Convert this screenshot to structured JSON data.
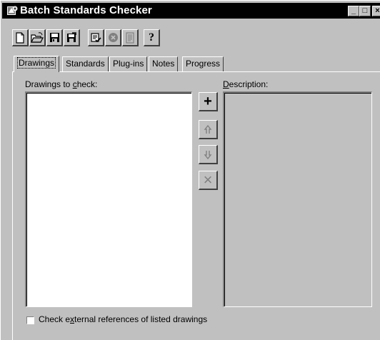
{
  "window": {
    "title": "Batch Standards Checker",
    "controls": {
      "minimize": "_",
      "maximize": "□",
      "close": "×"
    }
  },
  "toolbar": {
    "buttons": [
      {
        "name": "new",
        "icon": "new-document-icon",
        "enabled": true
      },
      {
        "name": "open",
        "icon": "open-folder-icon",
        "enabled": true
      },
      {
        "name": "save",
        "icon": "save-disk-icon",
        "enabled": true
      },
      {
        "name": "save-as",
        "icon": "save-as-disk-icon",
        "enabled": true
      },
      {
        "name": "start-check",
        "icon": "start-check-icon",
        "enabled": true
      },
      {
        "name": "stop-check",
        "icon": "stop-check-icon",
        "enabled": false
      },
      {
        "name": "view-report",
        "icon": "report-icon",
        "enabled": false
      },
      {
        "name": "help",
        "icon": "help-icon",
        "label": "?",
        "enabled": true
      }
    ]
  },
  "tabs": [
    {
      "label": "Drawings",
      "active": true
    },
    {
      "label": "Standards",
      "active": false
    },
    {
      "label": "Plug-ins",
      "active": false
    },
    {
      "label": "Notes",
      "active": false
    },
    {
      "label": "Progress",
      "active": false
    }
  ],
  "drawings_tab": {
    "list_label_pre": "Drawings to ",
    "list_label_accel": "c",
    "list_label_post": "heck:",
    "description_label_accel": "D",
    "description_label_post": "escription:",
    "items": [],
    "side_buttons": [
      {
        "name": "add",
        "glyph": "+",
        "enabled": true
      },
      {
        "name": "move-up",
        "icon": "move-up-arrow-icon",
        "enabled": false
      },
      {
        "name": "move-down",
        "icon": "move-down-arrow-icon",
        "enabled": false
      },
      {
        "name": "remove",
        "glyph": "×",
        "enabled": false
      }
    ],
    "check_xrefs": {
      "checked": false,
      "label_pre": "Check e",
      "label_accel": "x",
      "label_post": "ternal references of listed drawings"
    }
  },
  "colors": {
    "face": "#c0c0c0",
    "titlebar": "#000000",
    "highlight": "#ffffff",
    "shadow": "#808080",
    "dark_shadow": "#404040",
    "disabled": "#808080"
  }
}
